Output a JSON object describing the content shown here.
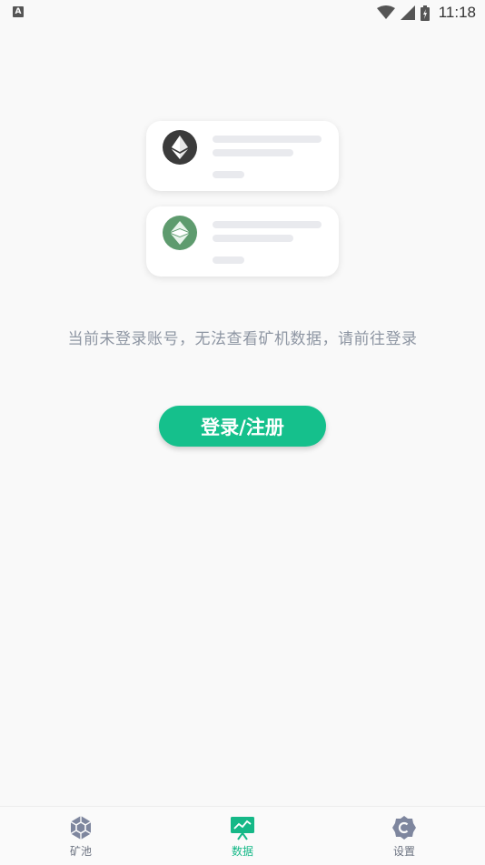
{
  "status_bar": {
    "indicator": "A",
    "time": "11:18",
    "icons": [
      "wifi-icon",
      "signal-icon",
      "battery-icon"
    ]
  },
  "illustration": {
    "cards": [
      {
        "coin": "eth-icon",
        "color": "#3b3b3b"
      },
      {
        "coin": "etc-icon",
        "color": "#5e9b6e"
      }
    ]
  },
  "main": {
    "notice": "当前未登录账号，无法查看矿机数据，请前往登录",
    "login_button": "登录/注册"
  },
  "bottom_nav": {
    "items": [
      {
        "label": "矿池",
        "icon": "cube-icon",
        "active": false
      },
      {
        "label": "数据",
        "icon": "chart-board-icon",
        "active": true
      },
      {
        "label": "设置",
        "icon": "settings-icon",
        "active": false
      }
    ]
  },
  "colors": {
    "accent": "#15c08c",
    "text_muted": "#8e96a3",
    "nav_inactive": "#7e869e"
  }
}
